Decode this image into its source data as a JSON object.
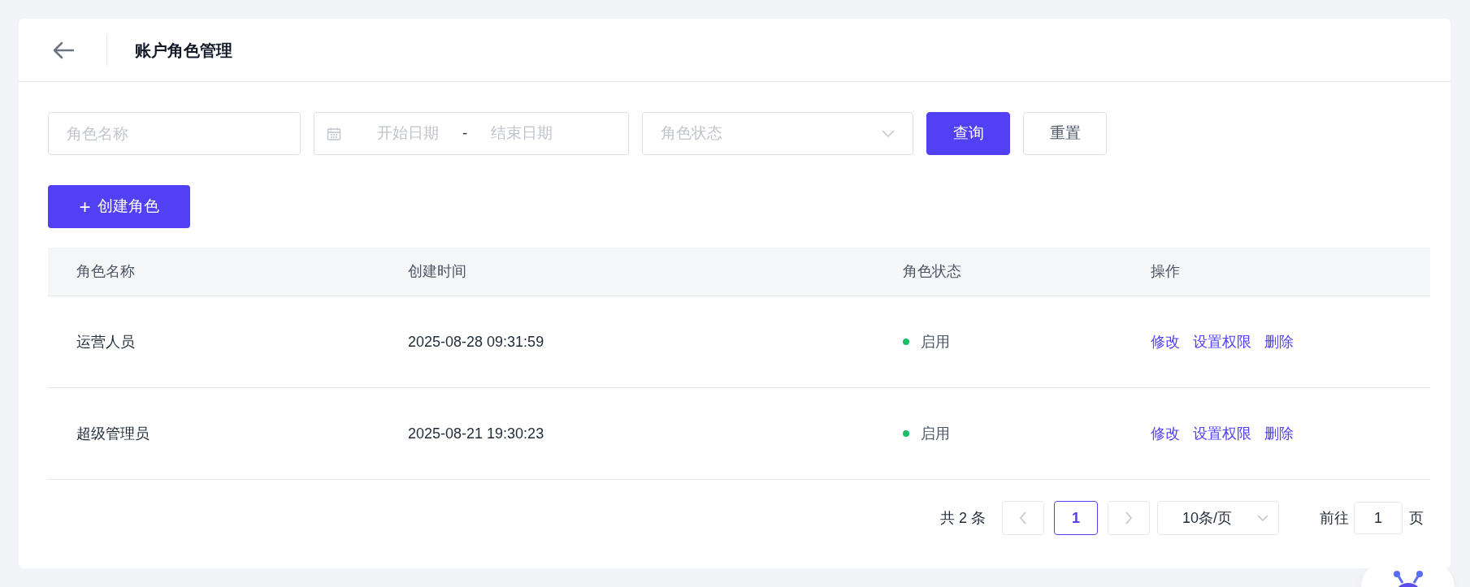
{
  "header": {
    "title": "账户角色管理"
  },
  "filters": {
    "name": {
      "placeholder": "角色名称"
    },
    "date_range": {
      "start_placeholder": "开始日期",
      "separator": "-",
      "end_placeholder": "结束日期"
    },
    "status": {
      "placeholder": "角色状态"
    },
    "buttons": [
      {
        "label": "查询",
        "kind": "primary"
      },
      {
        "label": "重置",
        "kind": "default"
      }
    ]
  },
  "create_button": {
    "icon": "+",
    "label": "创建角色"
  },
  "table": {
    "columns": [
      "角色名称",
      "创建时间",
      "角色状态",
      "操作"
    ],
    "rows": [
      {
        "name": "运营人员",
        "created": "2025-08-28 09:31:59",
        "status": {
          "label": "启用",
          "color": "#19be6b"
        },
        "actions": [
          "修改",
          "设置权限",
          "删除"
        ]
      },
      {
        "name": "超级管理员",
        "created": "2025-08-21 19:30:23",
        "status": {
          "label": "启用",
          "color": "#19be6b"
        },
        "actions": [
          "修改",
          "设置权限",
          "删除"
        ]
      }
    ]
  },
  "pagination": {
    "total": "共 2 条",
    "prev_disabled": true,
    "pages": [
      {
        "label": "1",
        "selected": true
      }
    ],
    "next_disabled": true,
    "page_size": "10条/页",
    "goto_label": "前往",
    "goto_value": "1",
    "goto_suffix": "页"
  }
}
